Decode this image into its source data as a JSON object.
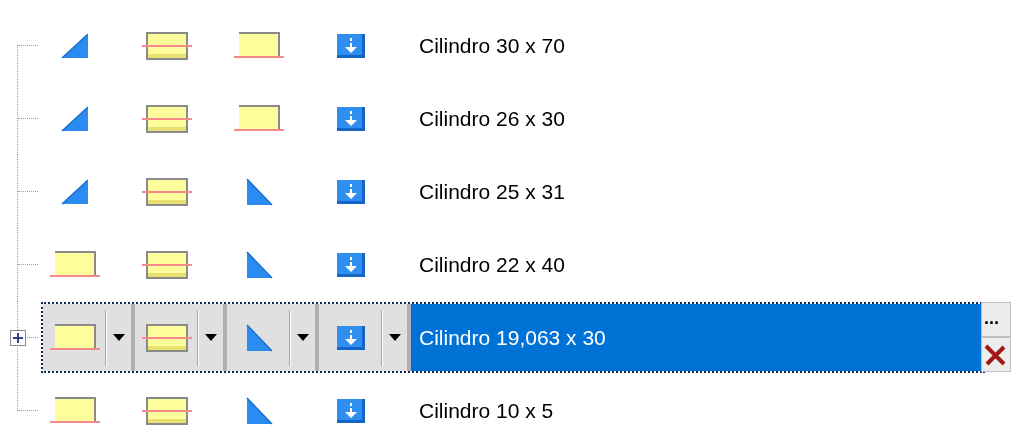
{
  "tree": {
    "items": [
      {
        "icons": [
          {
            "kind": "ramp"
          },
          {
            "kind": "box-mid"
          },
          {
            "kind": "box-bottom"
          },
          {
            "kind": "download"
          }
        ],
        "label": "Cilindro 30 x 70",
        "selected": false,
        "expandable": false
      },
      {
        "icons": [
          {
            "kind": "ramp"
          },
          {
            "kind": "box-mid"
          },
          {
            "kind": "box-bottom"
          },
          {
            "kind": "download"
          }
        ],
        "label": "Cilindro 26 x 30",
        "selected": false,
        "expandable": false
      },
      {
        "icons": [
          {
            "kind": "ramp"
          },
          {
            "kind": "box-mid"
          },
          {
            "kind": "wedge"
          },
          {
            "kind": "download"
          }
        ],
        "label": "Cilindro 25 x 31",
        "selected": false,
        "expandable": false
      },
      {
        "icons": [
          {
            "kind": "box-bottom"
          },
          {
            "kind": "box-mid"
          },
          {
            "kind": "wedge"
          },
          {
            "kind": "download"
          }
        ],
        "label": "Cilindro 22 x 40",
        "selected": false,
        "expandable": false
      },
      {
        "icons": [
          {
            "kind": "box-bottom"
          },
          {
            "kind": "box-mid"
          },
          {
            "kind": "wedge"
          },
          {
            "kind": "download"
          }
        ],
        "label": "Cilindro 19,063 x 30",
        "selected": true,
        "expandable": true
      },
      {
        "icons": [
          {
            "kind": "box-bottom"
          },
          {
            "kind": "box-mid"
          },
          {
            "kind": "wedge"
          },
          {
            "kind": "download"
          }
        ],
        "label": "Cilindro 10 x 5",
        "selected": false,
        "expandable": false
      }
    ]
  },
  "edit_buttons": [
    {
      "kind": "ellipsis",
      "label": "..."
    },
    {
      "kind": "clear"
    }
  ]
}
